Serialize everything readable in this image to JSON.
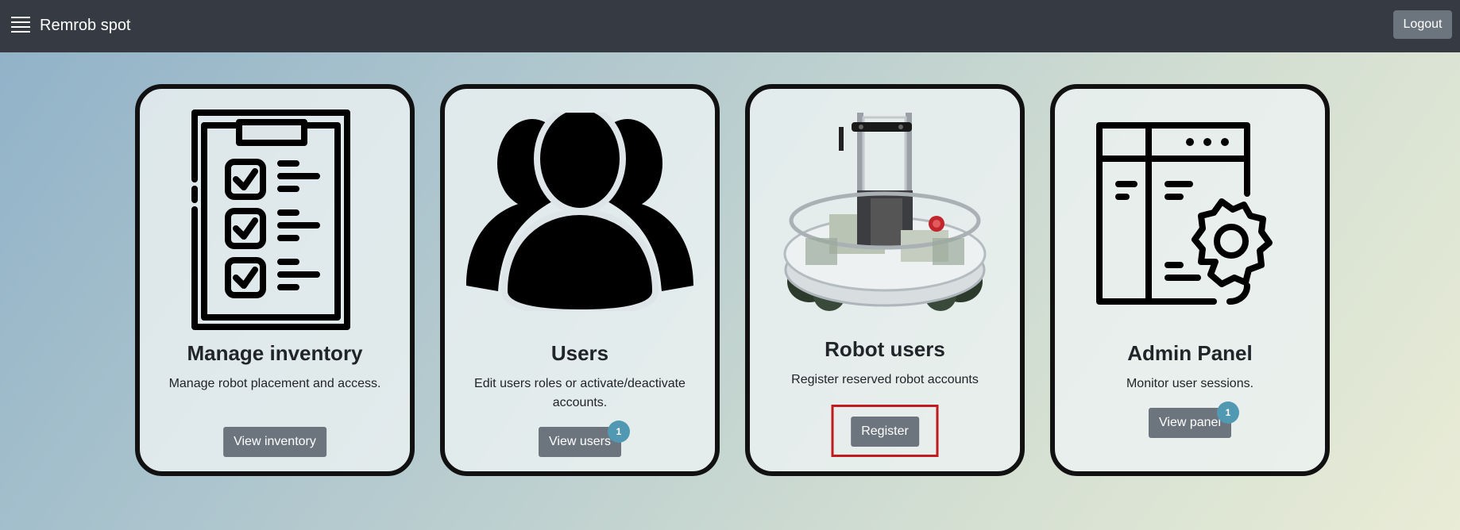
{
  "navbar": {
    "brand": "Remrob spot",
    "menu_icon": "hamburger-menu-icon",
    "logout_label": "Logout"
  },
  "cards": [
    {
      "title": "Manage inventory",
      "description": "Manage robot placement and access.",
      "button_label": "View inventory",
      "icon": "clipboard-checklist-icon"
    },
    {
      "title": "Users",
      "description": "Edit users roles or activate/deactivate accounts.",
      "button_label": "View users",
      "badge": "1",
      "icon": "users-group-icon"
    },
    {
      "title": "Robot users",
      "description": "Register reserved robot accounts",
      "button_label": "Register",
      "image": "robot-photo"
    },
    {
      "title": "Admin Panel",
      "description": "Monitor user sessions.",
      "button_label": "View panel",
      "badge": "1",
      "icon": "admin-panel-gear-icon"
    }
  ],
  "colors": {
    "navbar": "#353a43",
    "button": "#6c757d",
    "badge": "#5199b2",
    "highlight": "#c11a1f"
  }
}
